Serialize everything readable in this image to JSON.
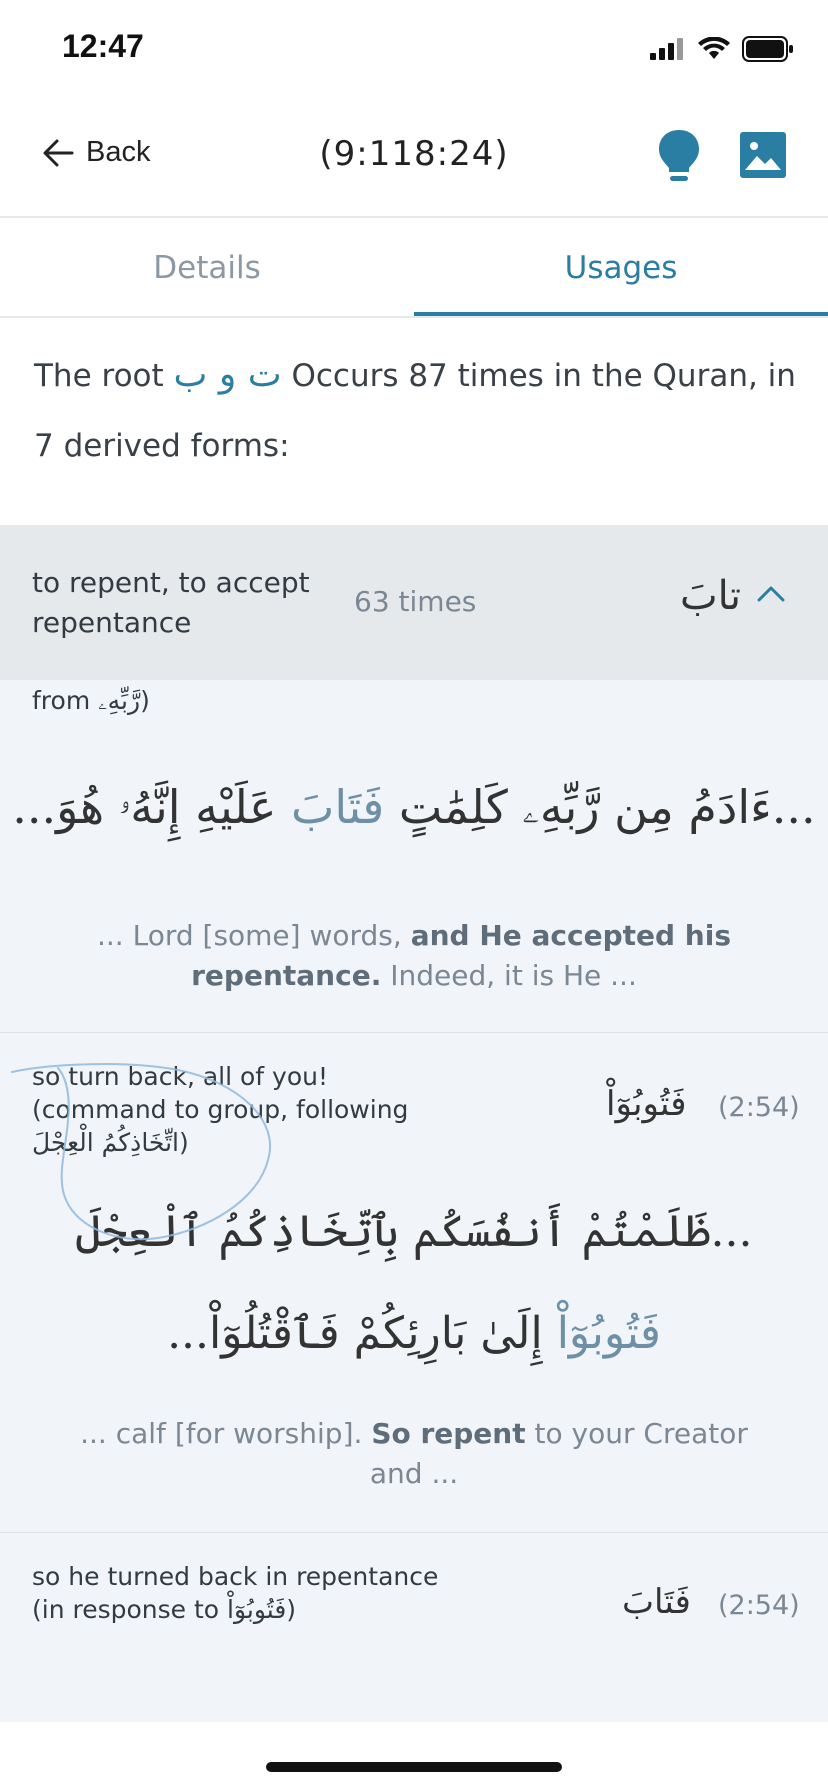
{
  "status": {
    "time": "12:47"
  },
  "nav": {
    "back_label": "Back",
    "title": "(9:118:24)"
  },
  "tabs": [
    {
      "label": "Details",
      "active": false
    },
    {
      "label": "Usages",
      "active": true
    }
  ],
  "intro": {
    "prefix": "The root",
    "root": "ت و ب",
    "suffix": "Occurs 87 times in the Quran, in 7 derived forms:"
  },
  "form": {
    "meaning": "to repent, to accept repentance",
    "count": "63 times",
    "arabic": "تابَ",
    "expanded": true
  },
  "usages": [
    {
      "meaning_tail": "from رَّبِّهِۦ)",
      "arabic_before": "...ءَادَمُ مِن رَّبِّهِۦ كَلِمَٰتٍ",
      "arabic_highlight": "فَتَابَ",
      "arabic_after": "عَلَيْهِ إِنَّهُۥ هُوَ...",
      "trans_before": "... Lord [some] words,",
      "trans_bold": "and He accepted his repentance.",
      "trans_after": "Indeed, it is He ..."
    },
    {
      "meaning": "so turn back, all of you! (command to group, following اتِّخَاذِكُمُ الْعِجْلَ)",
      "word": "فَتُوبُوٓاْ",
      "ref": "(2:54)",
      "arabic_line1": "...ظَلَمْتُمْ أَنفُسَكُم بِٱتِّخَاذِكُمُ ٱلْعِجْلَ",
      "arabic_highlight": "فَتُوبُوٓاْ",
      "arabic_line2_after": "إِلَىٰ بَارِئِكُمْ فَٱقْتُلُوٓاْ...",
      "trans_before": "... calf [for worship].",
      "trans_bold": "So repent",
      "trans_after": "to your Creator and ..."
    },
    {
      "meaning": "so he turned back in repentance (in response to فَتُوبُوٓاْ)",
      "word": "فَتَابَ",
      "ref": "(2:54)"
    }
  ],
  "colors": {
    "accent": "#2b7ea3",
    "header_bg": "#e6e9ec",
    "list_bg": "#f1f4f8"
  }
}
